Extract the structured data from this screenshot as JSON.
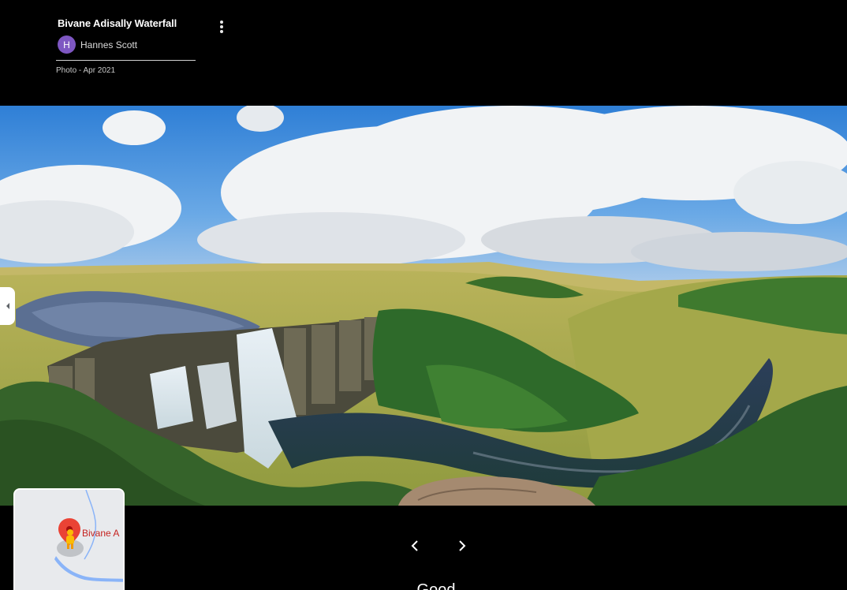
{
  "header": {
    "title": "Bivane Adisally Waterfall",
    "author": {
      "initial": "H",
      "name": "Hannes Scott",
      "avatar_color": "#7e57c2"
    },
    "photo_meta": "Photo - Apr 2021",
    "more_icon": "more-vert-icon"
  },
  "photo": {
    "subject": "waterfall-panorama"
  },
  "sidebar_toggle": {
    "icon": "chevron-left-icon"
  },
  "minimap": {
    "label": "Bivane A",
    "pin_color": "#ea4335",
    "pegman_color": "#fbbc04"
  },
  "navigation": {
    "prev_icon": "chevron-left-icon",
    "next_icon": "chevron-right-icon"
  },
  "bottom": {
    "heading": "Good"
  }
}
